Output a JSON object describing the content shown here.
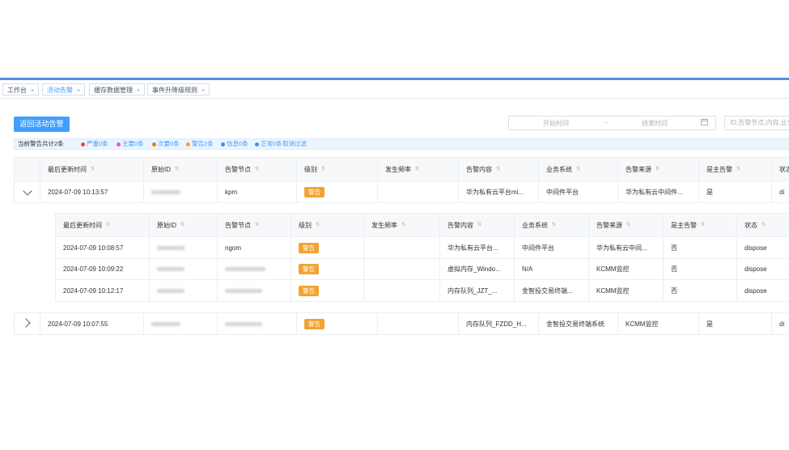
{
  "tabs": [
    {
      "label": "工作台",
      "active": false
    },
    {
      "label": "活动告警",
      "active": true
    },
    {
      "label": "缓存数据管理",
      "active": false
    },
    {
      "label": "事件升降级规则",
      "active": false
    }
  ],
  "close_glyph": "×",
  "toolbar": {
    "back_label": "返回活动告警"
  },
  "date_range": {
    "start_placeholder": "开始时间",
    "separator": "–",
    "end_placeholder": "结束时间",
    "icon": "calendar-icon"
  },
  "search": {
    "placeholder": "ID,告警节点,内容,业务"
  },
  "summary": {
    "total": "当前警告共计2条",
    "items": [
      {
        "label": "严重0条",
        "color": "#e74c3c"
      },
      {
        "label": "主要0条",
        "color": "#e65ac0"
      },
      {
        "label": "次要0条",
        "color": "#e67e22"
      },
      {
        "label": "警告2条",
        "color": "#f0a433"
      },
      {
        "label": "信息0条",
        "color": "#5b7ed8"
      },
      {
        "label": "正常0条",
        "color": "#4a90e2"
      }
    ],
    "clear": "取消过滤"
  },
  "columns": [
    "最后更新时间",
    "原始ID",
    "告警节点",
    "级别",
    "发生频率",
    "告警内容",
    "业务系统",
    "告警来源",
    "是主告警",
    "状态"
  ],
  "sort_glyph": "⇅",
  "outer_rows": [
    {
      "expanded": true,
      "time": "2024-07-09 10:13:57",
      "node": "kpm",
      "level": "警告",
      "freq": "",
      "content": "华为私有云平台mi...",
      "system": "中间件平台",
      "source": "华为私有云中间件...",
      "is_main": "是",
      "status": "di"
    },
    {
      "expanded": false,
      "time": "2024-07-09 10:07:55",
      "node": "",
      "level": "警告",
      "freq": "",
      "content": "内存队列_FZDD_H...",
      "system": "金智投交易终端系统",
      "source": "KCMM监控",
      "is_main": "是",
      "status": "di"
    }
  ],
  "inner_columns": [
    "最后更新时间",
    "原始ID",
    "告警节点",
    "级别",
    "发生频率",
    "告警内容",
    "业务系统",
    "告警来源",
    "是主告警",
    "状态"
  ],
  "inner_rows": [
    {
      "time": "2024-07-09 10:08:57",
      "node": "ngom",
      "level": "警告",
      "freq": "",
      "content": "华为私有云平台...",
      "system": "中间件平台",
      "source": "华为私有云中间...",
      "is_main": "否",
      "status": "dispose"
    },
    {
      "time": "2024-07-09 10:09:22",
      "node": "",
      "level": "警告",
      "freq": "",
      "content": "虚拟内存_Windo...",
      "system": "N/A",
      "source": "KCMM监控",
      "is_main": "否",
      "status": "dispose"
    },
    {
      "time": "2024-07-09 10:12:17",
      "node": "",
      "level": "警告",
      "freq": "",
      "content": "内存队列_JZT_...",
      "system": "金智投交易终端...",
      "source": "KCMM监控",
      "is_main": "否",
      "status": "dispose"
    }
  ],
  "colors": {
    "accent": "#409eff",
    "warning": "#f0a433"
  }
}
